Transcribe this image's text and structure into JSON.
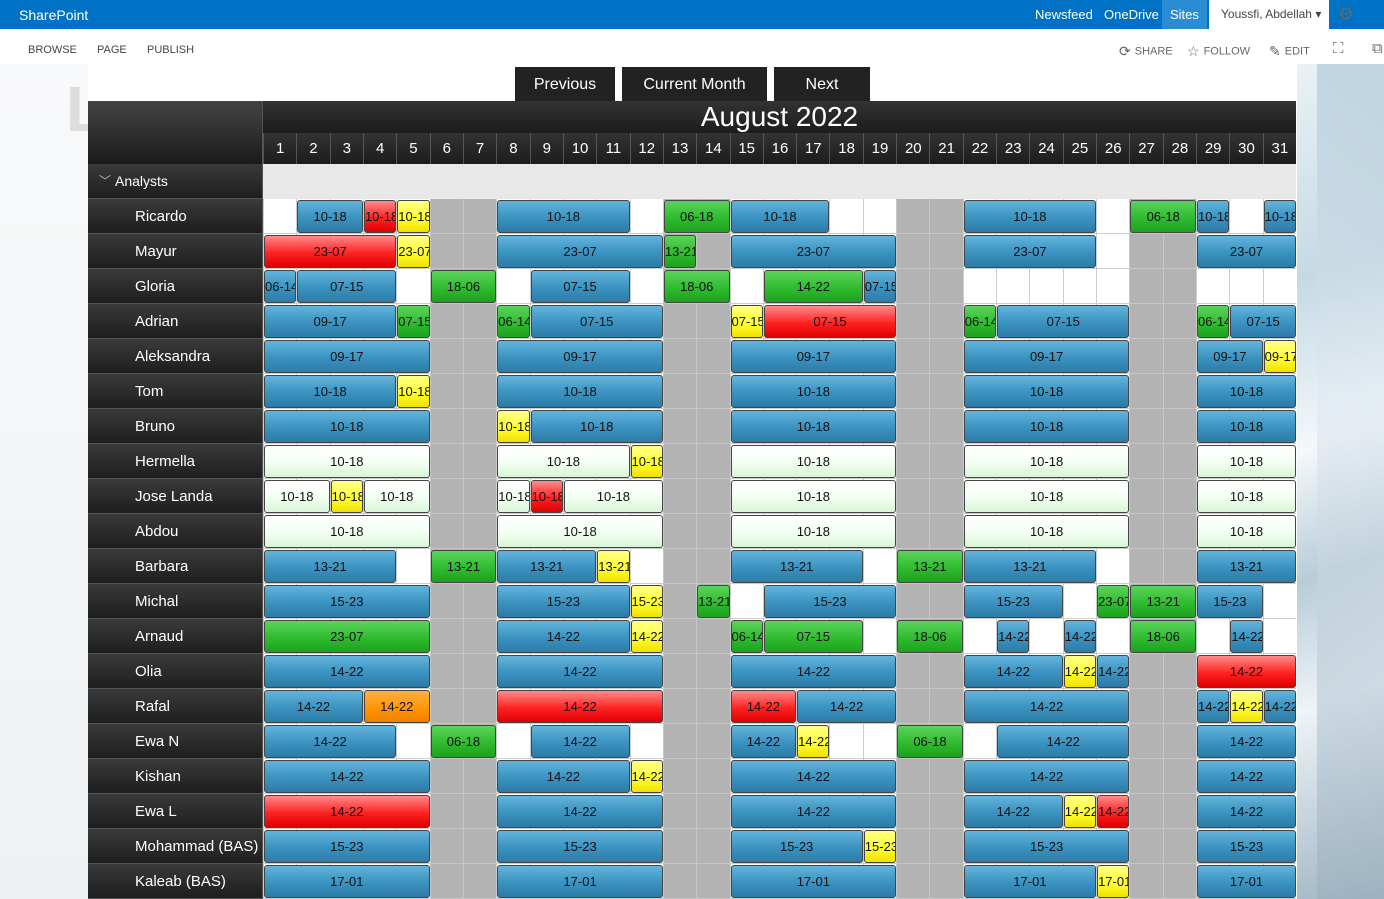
{
  "suite": {
    "brand": "SharePoint",
    "links": [
      "Newsfeed",
      "OneDrive",
      "Sites"
    ],
    "active_link": "Sites",
    "user": "Youssfi, Abdellah"
  },
  "ribbon": {
    "tabs": [
      "BROWSE",
      "PAGE",
      "PUBLISH"
    ],
    "actions": [
      {
        "label": "SHARE",
        "icon": "share-icon"
      },
      {
        "label": "FOLLOW",
        "icon": "star-icon"
      },
      {
        "label": "EDIT",
        "icon": "pencil-icon"
      }
    ]
  },
  "nav": {
    "previous": "Previous",
    "current": "Current Month",
    "next": "Next"
  },
  "calendar": {
    "month": "August 2022",
    "group": "Analysts",
    "days": [
      1,
      2,
      3,
      4,
      5,
      6,
      7,
      8,
      9,
      10,
      11,
      12,
      13,
      14,
      15,
      16,
      17,
      18,
      19,
      20,
      21,
      22,
      23,
      24,
      25,
      26,
      27,
      28,
      29,
      30,
      31
    ],
    "weekend_days": [
      6,
      7,
      13,
      14,
      20,
      21,
      27,
      28
    ],
    "colors": {
      "blue": "#3a92c0",
      "green": "#2cb92c",
      "red": "#ee1111",
      "yellow": "#ffff33",
      "orange": "#ff9400",
      "light": "#eafbe8"
    },
    "people": [
      {
        "name": "Ricardo",
        "shifts": [
          [
            2,
            3,
            "10-18",
            "blue"
          ],
          [
            4,
            4,
            "10-18",
            "red"
          ],
          [
            5,
            5,
            "10-18",
            "yellow"
          ],
          [
            8,
            11,
            "10-18",
            "blue"
          ],
          [
            13,
            14,
            "06-18",
            "green"
          ],
          [
            15,
            17,
            "10-18",
            "blue"
          ],
          [
            22,
            25,
            "10-18",
            "blue"
          ],
          [
            27,
            28,
            "06-18",
            "green"
          ],
          [
            29,
            29,
            "10-18",
            "blue"
          ],
          [
            31,
            31,
            "10-18",
            "blue"
          ]
        ]
      },
      {
        "name": "Mayur",
        "shifts": [
          [
            1,
            4,
            "23-07",
            "red"
          ],
          [
            5,
            5,
            "23-07",
            "yellow"
          ],
          [
            8,
            12,
            "23-07",
            "blue"
          ],
          [
            13,
            13,
            "13-21",
            "green"
          ],
          [
            15,
            19,
            "23-07",
            "blue"
          ],
          [
            22,
            25,
            "23-07",
            "blue"
          ],
          [
            29,
            31,
            "23-07",
            "blue"
          ]
        ]
      },
      {
        "name": "Gloria",
        "shifts": [
          [
            1,
            1,
            "06-14",
            "blue"
          ],
          [
            2,
            4,
            "07-15",
            "blue"
          ],
          [
            6,
            7,
            "18-06",
            "green"
          ],
          [
            9,
            11,
            "07-15",
            "blue"
          ],
          [
            13,
            14,
            "18-06",
            "green"
          ],
          [
            16,
            18,
            "14-22",
            "green"
          ],
          [
            19,
            19,
            "07-15",
            "blue"
          ]
        ]
      },
      {
        "name": "Adrian",
        "shifts": [
          [
            1,
            4,
            "09-17",
            "blue"
          ],
          [
            5,
            5,
            "07-15",
            "green"
          ],
          [
            8,
            8,
            "06-14",
            "green"
          ],
          [
            9,
            12,
            "07-15",
            "blue"
          ],
          [
            15,
            15,
            "07-15",
            "yellow"
          ],
          [
            16,
            19,
            "07-15",
            "red"
          ],
          [
            22,
            22,
            "06-14",
            "green"
          ],
          [
            23,
            26,
            "07-15",
            "blue"
          ],
          [
            29,
            29,
            "06-14",
            "green"
          ],
          [
            30,
            31,
            "07-15",
            "blue"
          ]
        ]
      },
      {
        "name": "Aleksandra",
        "shifts": [
          [
            1,
            5,
            "09-17",
            "blue"
          ],
          [
            8,
            12,
            "09-17",
            "blue"
          ],
          [
            15,
            19,
            "09-17",
            "blue"
          ],
          [
            22,
            26,
            "09-17",
            "blue"
          ],
          [
            29,
            30,
            "09-17",
            "blue"
          ],
          [
            31,
            31,
            "09-17",
            "yellow"
          ]
        ]
      },
      {
        "name": "Tom",
        "shifts": [
          [
            1,
            4,
            "10-18",
            "blue"
          ],
          [
            5,
            5,
            "10-18",
            "yellow"
          ],
          [
            8,
            12,
            "10-18",
            "blue"
          ],
          [
            15,
            19,
            "10-18",
            "blue"
          ],
          [
            22,
            26,
            "10-18",
            "blue"
          ],
          [
            29,
            31,
            "10-18",
            "blue"
          ]
        ]
      },
      {
        "name": "Bruno",
        "shifts": [
          [
            1,
            5,
            "10-18",
            "blue"
          ],
          [
            8,
            8,
            "10-18",
            "yellow"
          ],
          [
            9,
            12,
            "10-18",
            "blue"
          ],
          [
            15,
            19,
            "10-18",
            "blue"
          ],
          [
            22,
            26,
            "10-18",
            "blue"
          ],
          [
            29,
            31,
            "10-18",
            "blue"
          ]
        ]
      },
      {
        "name": "Hermella",
        "shifts": [
          [
            1,
            5,
            "10-18",
            "light"
          ],
          [
            8,
            11,
            "10-18",
            "light"
          ],
          [
            12,
            12,
            "10-18",
            "yellow"
          ],
          [
            15,
            19,
            "10-18",
            "light"
          ],
          [
            22,
            26,
            "10-18",
            "light"
          ],
          [
            29,
            31,
            "10-18",
            "light"
          ]
        ]
      },
      {
        "name": "Jose Landa",
        "shifts": [
          [
            1,
            2,
            "10-18",
            "light"
          ],
          [
            3,
            3,
            "10-18",
            "yellow"
          ],
          [
            4,
            5,
            "10-18",
            "light"
          ],
          [
            8,
            8,
            "10-18",
            "light"
          ],
          [
            9,
            9,
            "10-18",
            "red"
          ],
          [
            10,
            12,
            "10-18",
            "light"
          ],
          [
            15,
            19,
            "10-18",
            "light"
          ],
          [
            22,
            26,
            "10-18",
            "light"
          ],
          [
            29,
            31,
            "10-18",
            "light"
          ]
        ]
      },
      {
        "name": "Abdou",
        "shifts": [
          [
            1,
            5,
            "10-18",
            "light"
          ],
          [
            8,
            12,
            "10-18",
            "light"
          ],
          [
            15,
            19,
            "10-18",
            "light"
          ],
          [
            22,
            26,
            "10-18",
            "light"
          ],
          [
            29,
            31,
            "10-18",
            "light"
          ]
        ]
      },
      {
        "name": "Barbara",
        "shifts": [
          [
            1,
            4,
            "13-21",
            "blue"
          ],
          [
            6,
            7,
            "13-21",
            "green"
          ],
          [
            8,
            10,
            "13-21",
            "blue"
          ],
          [
            11,
            11,
            "13-21",
            "yellow"
          ],
          [
            15,
            18,
            "13-21",
            "blue"
          ],
          [
            20,
            21,
            "13-21",
            "green"
          ],
          [
            22,
            25,
            "13-21",
            "blue"
          ],
          [
            29,
            31,
            "13-21",
            "blue"
          ]
        ]
      },
      {
        "name": "Michal",
        "shifts": [
          [
            1,
            5,
            "15-23",
            "blue"
          ],
          [
            8,
            11,
            "15-23",
            "blue"
          ],
          [
            12,
            12,
            "15-23",
            "yellow"
          ],
          [
            14,
            14,
            "13-21",
            "green"
          ],
          [
            16,
            19,
            "15-23",
            "blue"
          ],
          [
            22,
            24,
            "15-23",
            "blue"
          ],
          [
            26,
            26,
            "23-07",
            "green"
          ],
          [
            27,
            28,
            "13-21",
            "green"
          ],
          [
            29,
            30,
            "15-23",
            "blue"
          ]
        ]
      },
      {
        "name": "Arnaud",
        "shifts": [
          [
            1,
            5,
            "23-07",
            "green"
          ],
          [
            8,
            11,
            "14-22",
            "blue"
          ],
          [
            12,
            12,
            "14-22",
            "yellow"
          ],
          [
            15,
            15,
            "06-14",
            "green"
          ],
          [
            16,
            18,
            "07-15",
            "green"
          ],
          [
            20,
            21,
            "18-06",
            "green"
          ],
          [
            23,
            23,
            "14-22",
            "blue"
          ],
          [
            25,
            25,
            "14-22",
            "blue"
          ],
          [
            27,
            28,
            "18-06",
            "green"
          ],
          [
            30,
            30,
            "14-22",
            "blue"
          ]
        ]
      },
      {
        "name": "Olia",
        "shifts": [
          [
            1,
            5,
            "14-22",
            "blue"
          ],
          [
            8,
            12,
            "14-22",
            "blue"
          ],
          [
            15,
            19,
            "14-22",
            "blue"
          ],
          [
            22,
            24,
            "14-22",
            "blue"
          ],
          [
            25,
            25,
            "14-22",
            "yellow"
          ],
          [
            26,
            26,
            "14-22",
            "blue"
          ],
          [
            29,
            31,
            "14-22",
            "red"
          ]
        ]
      },
      {
        "name": "Rafal",
        "shifts": [
          [
            1,
            3,
            "14-22",
            "blue"
          ],
          [
            4,
            5,
            "14-22",
            "orange"
          ],
          [
            8,
            12,
            "14-22",
            "red"
          ],
          [
            15,
            16,
            "14-22",
            "red"
          ],
          [
            17,
            19,
            "14-22",
            "blue"
          ],
          [
            22,
            26,
            "14-22",
            "blue"
          ],
          [
            29,
            29,
            "14-22",
            "blue"
          ],
          [
            30,
            30,
            "14-22",
            "yellow"
          ],
          [
            31,
            31,
            "14-22",
            "blue"
          ]
        ]
      },
      {
        "name": "Ewa N",
        "shifts": [
          [
            1,
            4,
            "14-22",
            "blue"
          ],
          [
            6,
            7,
            "06-18",
            "green"
          ],
          [
            9,
            11,
            "14-22",
            "blue"
          ],
          [
            15,
            16,
            "14-22",
            "blue"
          ],
          [
            17,
            17,
            "14-22",
            "yellow"
          ],
          [
            20,
            21,
            "06-18",
            "green"
          ],
          [
            23,
            26,
            "14-22",
            "blue"
          ],
          [
            29,
            31,
            "14-22",
            "blue"
          ]
        ]
      },
      {
        "name": "Kishan",
        "shifts": [
          [
            1,
            5,
            "14-22",
            "blue"
          ],
          [
            8,
            11,
            "14-22",
            "blue"
          ],
          [
            12,
            12,
            "14-22",
            "yellow"
          ],
          [
            15,
            19,
            "14-22",
            "blue"
          ],
          [
            22,
            26,
            "14-22",
            "blue"
          ],
          [
            29,
            31,
            "14-22",
            "blue"
          ]
        ]
      },
      {
        "name": "Ewa L",
        "shifts": [
          [
            1,
            5,
            "14-22",
            "red"
          ],
          [
            8,
            12,
            "14-22",
            "blue"
          ],
          [
            15,
            19,
            "14-22",
            "blue"
          ],
          [
            22,
            24,
            "14-22",
            "blue"
          ],
          [
            25,
            25,
            "14-22",
            "yellow"
          ],
          [
            26,
            26,
            "14-22",
            "red"
          ],
          [
            29,
            31,
            "14-22",
            "blue"
          ]
        ]
      },
      {
        "name": "Mohammad (BAS)",
        "shifts": [
          [
            1,
            5,
            "15-23",
            "blue"
          ],
          [
            8,
            12,
            "15-23",
            "blue"
          ],
          [
            15,
            18,
            "15-23",
            "blue"
          ],
          [
            19,
            19,
            "15-23",
            "yellow"
          ],
          [
            22,
            26,
            "15-23",
            "blue"
          ],
          [
            29,
            31,
            "15-23",
            "blue"
          ]
        ]
      },
      {
        "name": "Kaleab (BAS)",
        "shifts": [
          [
            1,
            5,
            "17-01",
            "blue"
          ],
          [
            8,
            12,
            "17-01",
            "blue"
          ],
          [
            15,
            19,
            "17-01",
            "blue"
          ],
          [
            22,
            25,
            "17-01",
            "blue"
          ],
          [
            26,
            26,
            "17-01",
            "yellow"
          ],
          [
            29,
            31,
            "17-01",
            "blue"
          ]
        ]
      }
    ]
  }
}
